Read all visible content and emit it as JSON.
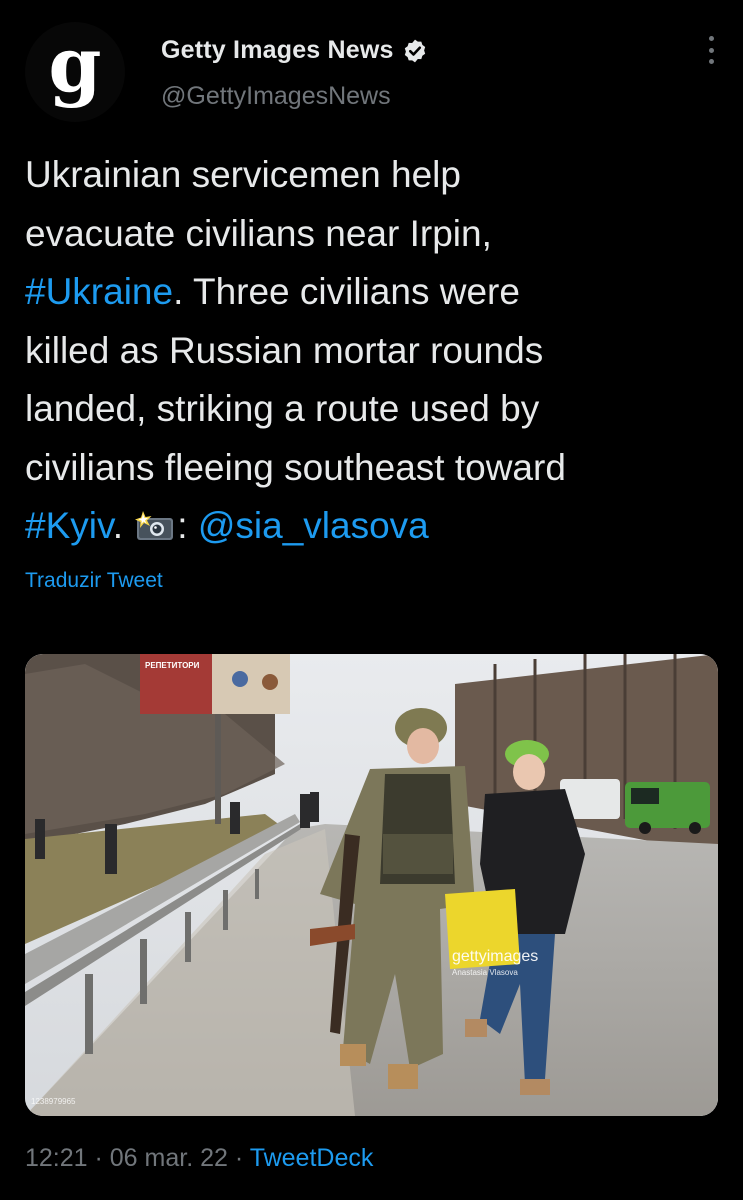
{
  "account": {
    "avatar_letter": "g",
    "display_name": "Getty Images News",
    "handle": "@GettyImagesNews",
    "verified": true
  },
  "tweet": {
    "lines": [
      [
        {
          "text": "Ukrainian servicemen help"
        }
      ],
      [
        {
          "text": "evacuate civilians near Irpin,"
        }
      ],
      [
        {
          "text": "#Ukraine",
          "link": true
        },
        {
          "text": ". Three civilians were"
        }
      ],
      [
        {
          "text": "killed as Russian mortar rounds"
        }
      ],
      [
        {
          "text": "landed, striking a route used by"
        }
      ],
      [
        {
          "text": "civilians fleeing southeast toward"
        }
      ],
      [
        {
          "text": "#Kyiv",
          "link": true
        },
        {
          "text": ". "
        },
        {
          "icon": "camera-flash-icon"
        },
        {
          "text": ": "
        },
        {
          "text": "@sia_vlasova",
          "link": true
        }
      ]
    ],
    "translate_label": "Traduzir Tweet"
  },
  "media": {
    "alt_description": "Soldier and woman walking along road",
    "watermark": "gettyimages",
    "credit": "Anastasia Vlasova",
    "image_id": "1238979965",
    "billboard_text": "РЕПЕТИТОРИ"
  },
  "footer": {
    "time": "12:21",
    "separator": " · ",
    "date": "06 mar. 22",
    "source": "TweetDeck"
  },
  "colors": {
    "background": "#000000",
    "text": "#e7e9ea",
    "secondary": "#71767b",
    "link": "#1d9bf0"
  }
}
